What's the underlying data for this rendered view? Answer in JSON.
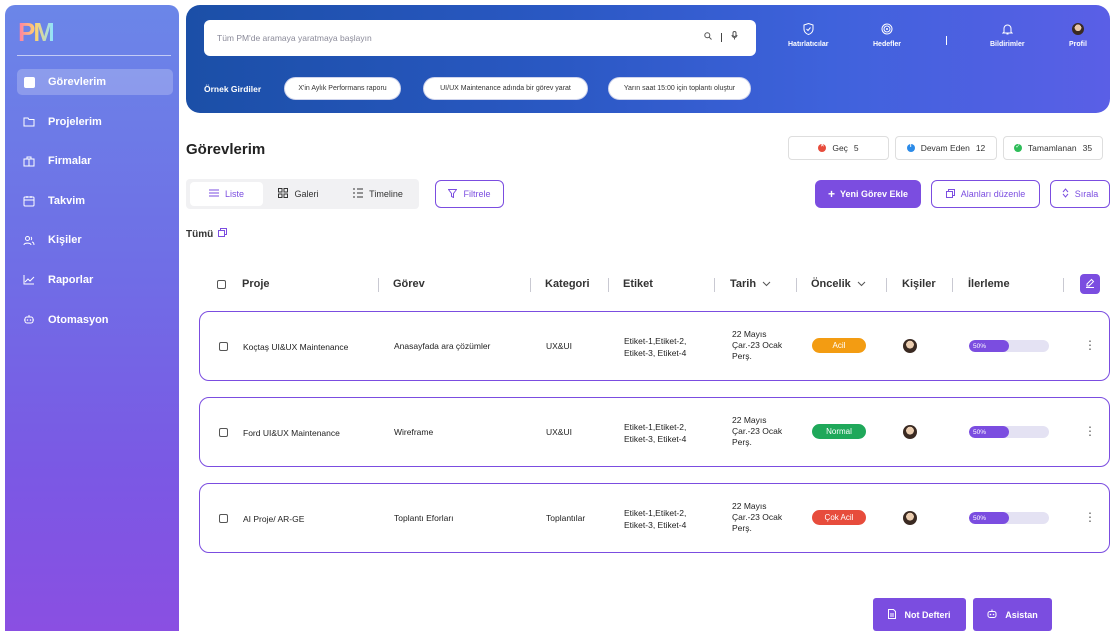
{
  "app": {
    "logo": "PM"
  },
  "sidebar": {
    "items": [
      {
        "label": "Görevlerim",
        "icon": "tasks-icon",
        "active": true
      },
      {
        "label": "Projelerim",
        "icon": "folder-icon"
      },
      {
        "label": "Firmalar",
        "icon": "building-icon"
      },
      {
        "label": "Takvim",
        "icon": "calendar-icon"
      },
      {
        "label": "Kişiler",
        "icon": "users-icon"
      },
      {
        "label": "Raporlar",
        "icon": "chart-icon"
      },
      {
        "label": "Otomasyon",
        "icon": "automation-icon"
      }
    ]
  },
  "header": {
    "search": {
      "placeholder": "Tüm PM'de aramaya yaratmaya başlayın"
    },
    "items": [
      {
        "label": "Hatırlatıcılar",
        "icon": "reminder-icon"
      },
      {
        "label": "Hedefler",
        "icon": "target-icon"
      },
      {
        "label": "Bildirimler",
        "icon": "bell-icon"
      },
      {
        "label": "Profil",
        "icon": "avatar"
      }
    ],
    "examples_label": "Örnek Girdiler",
    "examples": [
      "X'in Aylık Performans raporu",
      "UI/UX Maintenance adında bir görev yarat",
      "Yarın saat 15:00 için toplantı oluştur"
    ]
  },
  "page": {
    "title": "Görevlerim",
    "counters": [
      {
        "label": "Geç",
        "value": "5",
        "color": "#e74c3c"
      },
      {
        "label": "Devam Eden",
        "value": "12",
        "color": "#2c8be8"
      },
      {
        "label": "Tamamlanan",
        "value": "35",
        "color": "#2ebd59"
      }
    ],
    "views": [
      "Liste",
      "Galeri",
      "Timeline"
    ],
    "filter_label": "Filtrele",
    "new_task_label": "Yeni Görev Ekle",
    "edit_fields_label": "Alanları düzenle",
    "sort_label": "Sırala",
    "all_label": "Tümü"
  },
  "table": {
    "columns": [
      "Proje",
      "Görev",
      "Kategori",
      "Etiket",
      "Tarih",
      "Öncelik",
      "Kişiler",
      "İlerleme"
    ],
    "rows": [
      {
        "project": "Koçtaş UI&UX Maintenance",
        "task": "Anasayfada ara çözümler",
        "category": "UX&UI",
        "tags_l1": "Etiket-1,Etiket-2,",
        "tags_l2": "Etiket-3, Etiket-4",
        "date_l1": "22 Mayıs",
        "date_l2": "Çar.-23 Ocak",
        "date_l3": "Perş.",
        "priority": "Acil",
        "priority_color": "#f39c12",
        "progress": 50,
        "progress_label": "50%"
      },
      {
        "project": "Ford UI&UX Maintenance",
        "task": "Wireframe",
        "category": "UX&UI",
        "tags_l1": "Etiket-1,Etiket-2,",
        "tags_l2": "Etiket-3, Etiket-4",
        "date_l1": "22 Mayıs",
        "date_l2": "Çar.-23 Ocak",
        "date_l3": "Perş.",
        "priority": "Normal",
        "priority_color": "#1fa85a",
        "progress": 50,
        "progress_label": "50%"
      },
      {
        "project": "AI Proje/ AR-GE",
        "task": "Toplantı Eforları",
        "category": "Toplantılar",
        "tags_l1": "Etiket-1,Etiket-2,",
        "tags_l2": "Etiket-3, Etiket-4",
        "date_l1": "22 Mayıs",
        "date_l2": "Çar.-23 Ocak",
        "date_l3": "Perş.",
        "priority": "Çok Acil",
        "priority_color": "#e74c3c",
        "progress": 50,
        "progress_label": "50%"
      }
    ]
  },
  "footer": {
    "notes_label": "Not Defteri",
    "assistant_label": "Asistan"
  },
  "colors": {
    "accent": "#7b4de0",
    "banner": "#2a58c3"
  }
}
